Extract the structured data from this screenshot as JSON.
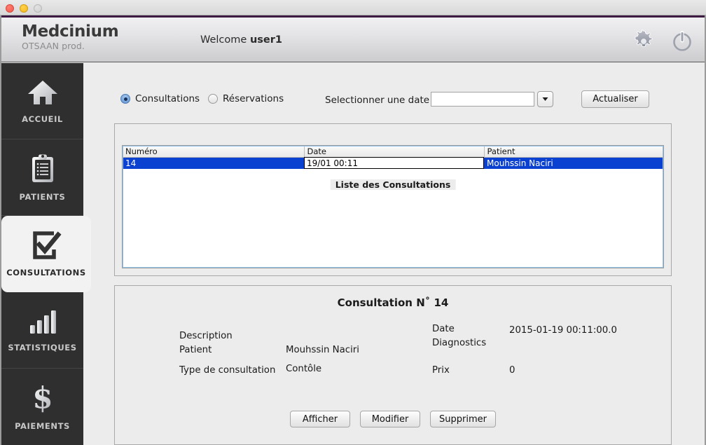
{
  "window": {
    "traffic_lights": [
      "close",
      "minimize",
      "zoom"
    ]
  },
  "header": {
    "brand_title": "Medcinium",
    "brand_subtitle": "OTSAAN prod.",
    "welcome_prefix": "Welcome",
    "welcome_user": "user1",
    "settings_icon": "gear-icon",
    "power_icon": "power-icon"
  },
  "sidebar": {
    "items": [
      {
        "label": "ACCUEIL",
        "icon": "home-icon",
        "active": false
      },
      {
        "label": "PATIENTS",
        "icon": "clipboard-icon",
        "active": false
      },
      {
        "label": "CONSULTATIONS",
        "icon": "checkbox-icon",
        "active": true
      },
      {
        "label": "STATISTIQUES",
        "icon": "bar-chart-icon",
        "active": false
      },
      {
        "label": "PAIEMENTS",
        "icon": "dollar-sign-icon",
        "active": false
      }
    ]
  },
  "toolbar": {
    "radios": [
      {
        "label": "Consultations",
        "selected": true
      },
      {
        "label": "Réservations",
        "selected": false
      }
    ],
    "date_label": "Selectionner une date",
    "date_value": "",
    "date_placeholder": "",
    "dropdown_icon": "chevron-down-icon",
    "refresh_label": "Actualiser"
  },
  "list_panel": {
    "legend": "Liste des Consultations",
    "columns": [
      "Numéro",
      "Date",
      "Patient"
    ],
    "rows": [
      {
        "numero": "14",
        "date": "19/01 00:11",
        "patient": "Mouhssin Naciri",
        "selected": true,
        "editing_cell": "date"
      }
    ]
  },
  "detail_panel": {
    "title": "Consultation N˚ 14",
    "fields": [
      {
        "label": "Description",
        "value": ""
      },
      {
        "label": "Patient",
        "value": "Mouhssin Naciri"
      },
      {
        "label": "Type de consultation",
        "value": "Contôle"
      },
      {
        "label": "Date",
        "value": "2015-01-19 00:11:00.0"
      },
      {
        "label": "Diagnostics",
        "value": ""
      },
      {
        "label": "Prix",
        "value": "0"
      }
    ],
    "buttons": [
      "Afficher",
      "Modifier",
      "Supprimer"
    ]
  },
  "colors": {
    "selection_blue": "#0b41d0",
    "accent_purple": "#3d1b42",
    "sidebar_dark": "#2f2f2f",
    "panel_grey": "#ececec"
  }
}
